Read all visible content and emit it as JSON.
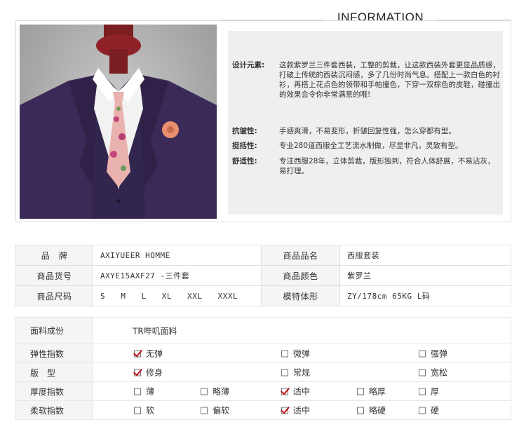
{
  "header": {
    "title": "INFORMATION"
  },
  "description": {
    "design": {
      "label": "设计元素:",
      "text": "这款紫罗兰三件套西装，工整的剪裁，让这款西装外套更显品质感，打破上传统的西装沉闷感，多了几份时尚气息。搭配上一款白色的衬衫，再搭上花点色的领带和手帕撞色，下穿一双棕色的皮鞋，碰撞出的效果会令你非常满意的哦!"
    },
    "wrinkle": {
      "label": "抗皱性:",
      "text": "手感爽滑，不易变形，折皱回复性强，怎么穿都有型。"
    },
    "crisp": {
      "label": "挺括性:",
      "text": "专业280道西服全工艺流水制做，尽显非凡，灵致有型。"
    },
    "comfort": {
      "label": "舒适性:",
      "text": "专注西服28年，立体剪裁，版形独到，符合人体舒展，不易沾灰，易打理。"
    }
  },
  "spec": {
    "brand_label": "品　牌",
    "brand_value": "AXIYUEER HOMME",
    "name_label": "商品品名",
    "name_value": "西服套装",
    "sku_label": "商品货号",
    "sku_value": "AXYE15AXF27 -三件套",
    "color_label": "商品颜色",
    "color_value": "紫罗兰",
    "size_label": "商品尺码",
    "sizes": [
      "S",
      "M",
      "L",
      "XL",
      "XXL",
      "XXXL"
    ],
    "model_label": "模特体形",
    "model_value": "ZY/178cm 65KG L码"
  },
  "fabric": {
    "label": "面料成份",
    "value": "TR哔叽面料",
    "rows": [
      {
        "label": "弹性指数",
        "options": [
          {
            "text": "无弹",
            "checked": true
          },
          {
            "text": "微弹",
            "checked": false
          },
          {
            "text": "强弹",
            "checked": false
          }
        ]
      },
      {
        "label": "版　型",
        "options": [
          {
            "text": "修身",
            "checked": true
          },
          {
            "text": "常规",
            "checked": false
          },
          {
            "text": "宽松",
            "checked": false
          }
        ]
      },
      {
        "label": "厚度指数",
        "options": [
          {
            "text": "薄",
            "checked": false
          },
          {
            "text": "略薄",
            "checked": false
          },
          {
            "text": "适中",
            "checked": true
          },
          {
            "text": "略厚",
            "checked": false
          },
          {
            "text": "厚",
            "checked": false
          }
        ]
      },
      {
        "label": "柔软指数",
        "options": [
          {
            "text": "软",
            "checked": false
          },
          {
            "text": "偏软",
            "checked": false
          },
          {
            "text": "适中",
            "checked": true
          },
          {
            "text": "略硬",
            "checked": false
          },
          {
            "text": "硬",
            "checked": false
          }
        ]
      }
    ]
  },
  "colors": {
    "check": "#c0141a",
    "suit": "#3b2a57",
    "tie": "#e9b2ae"
  }
}
